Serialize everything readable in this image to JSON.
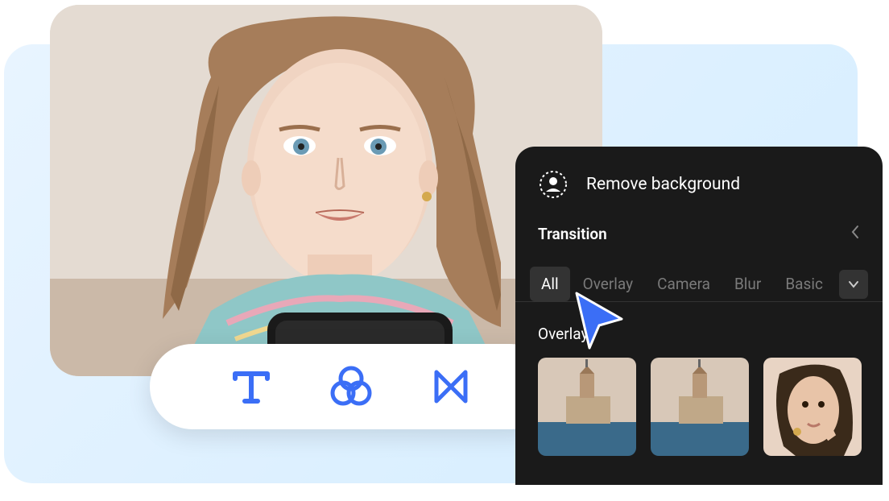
{
  "panel": {
    "header_title": "Remove background",
    "section_title": "Transition",
    "tabs": [
      "All",
      "Overlay",
      "Camera",
      "Blur",
      "Basic"
    ],
    "active_tab_index": 0,
    "subsection_title": "Overlay"
  },
  "toolbar": {
    "tools": [
      "text",
      "filter",
      "transition"
    ]
  },
  "colors": {
    "accent_blue": "#3b6ef6",
    "panel_bg": "#1a1a1a",
    "tab_active_bg": "#333333",
    "tab_inactive": "#7a7a7a"
  }
}
